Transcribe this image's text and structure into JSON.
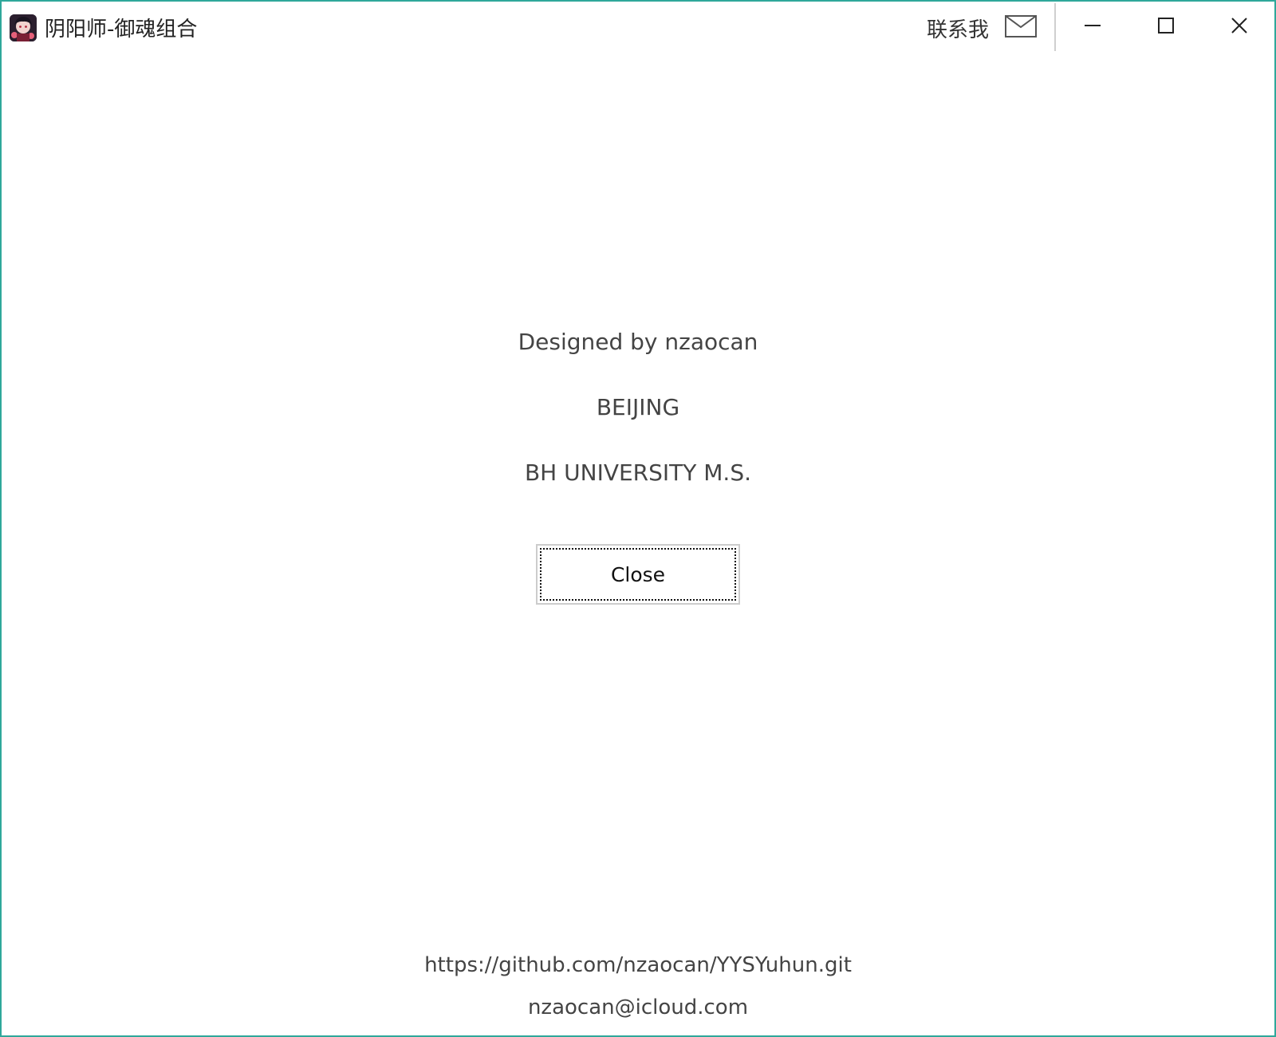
{
  "window": {
    "title": "阴阳师-御魂组合",
    "contact_label": "联系我",
    "icons": {
      "app": "app-avatar-icon",
      "mail": "mail-icon",
      "minimize": "minimize-icon",
      "maximize": "maximize-icon",
      "close": "close-icon"
    },
    "border_color": "#2fa89a"
  },
  "about": {
    "designed_by": "Designed by nzaocan",
    "city": "BEIJING",
    "university": "BH UNIVERSITY M.S.",
    "close_label": "Close"
  },
  "footer": {
    "repo_url": "https://github.com/nzaocan/YYSYuhun.git",
    "email": "nzaocan@icloud.com"
  }
}
